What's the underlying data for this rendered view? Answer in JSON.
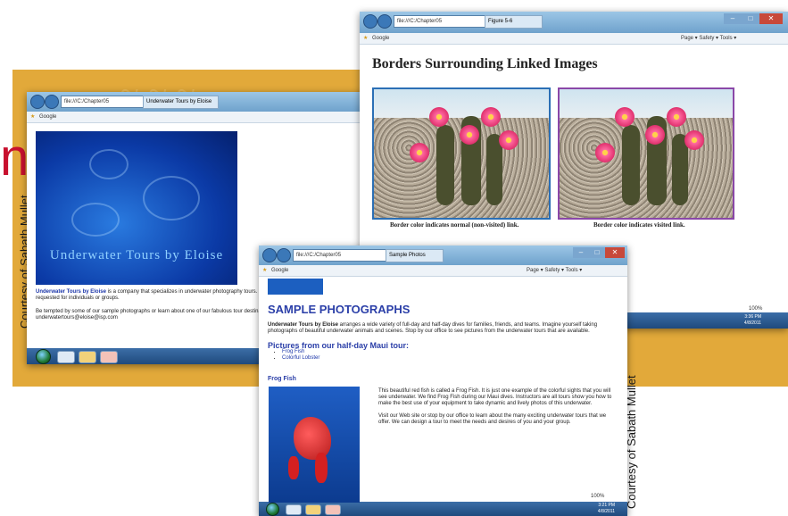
{
  "background": {
    "band_color": "#e2a93a",
    "accent_glyph": "n",
    "credit_left": "Courtesy of Sabath Mullet",
    "credit_right": "Courtesy of Sabath Mullet"
  },
  "window_left": {
    "tab_title": "Underwater Tours by Eloise",
    "favorites": "Google",
    "banner_text": "Underwater Tours by Eloise",
    "para1_bold": "Underwater Tours by Eloise",
    "para1_rest": " is a company that specializes in underwater photography tours. Instruct... support. Tours can be requested for individuals or groups.",
    "para2": "Be tempted by some of our sample photographs or learn about one of our fabulous tour destinations. 555-ELOISE or e-mail us at underwatertours@eloise@isp.com",
    "link_photos": "sample photographs",
    "link_tours": "fabulous tour destinations",
    "link_email": "underwatertoursbyeloise@isp.com"
  },
  "window_right": {
    "tab_title": "Figure 5-6",
    "favorites": "Google",
    "menu": "Page ▾  Safety ▾  Tools ▾",
    "heading": "Borders Surrounding Linked Images",
    "caption_left": "Border color indicates normal (non-visited) link.",
    "caption_right": "Border color indicates visited link.",
    "border_normal": "#2b6fb5",
    "border_visited": "#8a47a8",
    "zoom": "100%",
    "time": "3:36 PM",
    "date": "4/8/2011"
  },
  "window_front": {
    "tab_title": "Sample Photos",
    "favorites": "Google",
    "menu": "Page ▾  Safety ▾  Tools ▾",
    "heading": "SAMPLE PHOTOGRAPHS",
    "intro_bold": "Underwater Tours by Eloise",
    "intro_rest": " arranges a wide variety of full-day and half-day dives for families, friends, and teams. Imagine yourself taking photographs of beautiful underwater animals and scenes. Stop by our office to see pictures from the underwater tours that are available.",
    "subheading": "Pictures from our half-day Maui tour:",
    "list": [
      "Frog Fish",
      "Colorful Lobster"
    ],
    "section_title": "Frog Fish",
    "body1": "This beautiful red fish is called a Frog Fish. It is just one example of the colorful sights that you will see underwater. We find Frog Fish during our Maui dives. Instructors are all tours show you how to make the best use of your equipment to take dynamic and lively photos of this underwater.",
    "body2": "Visit our Web site or stop by our office to learn about the many exciting underwater tours that we offer. We can design a tour to meet the needs and desires of you and your group.",
    "zoom": "100%",
    "time": "3:21 PM",
    "date": "4/8/2011",
    "heading_color": "#2b3fa8"
  }
}
